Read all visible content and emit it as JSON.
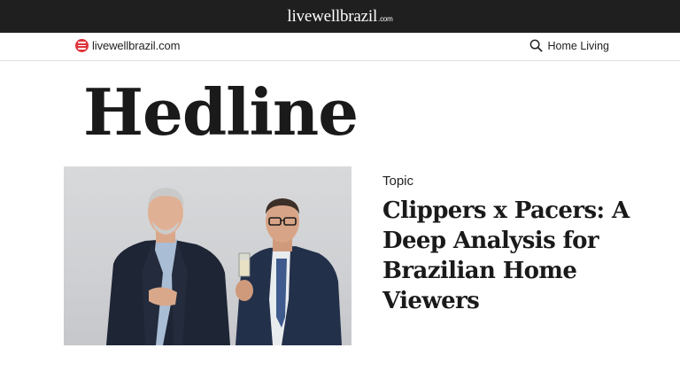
{
  "banner": {
    "brand_main": "livewellbrazil",
    "brand_tld": ".com"
  },
  "nav": {
    "logo_text": "livewellbrazil.com",
    "logo_icon": "menu-lines-icon",
    "search_icon": "search-icon",
    "link_label": "Home Living"
  },
  "headline": "Hedline",
  "article": {
    "topic": "Topic",
    "title": "Clippers x Pacers: A Deep Analysis for Brazilian Home Viewers"
  },
  "colors": {
    "banner_bg": "#1f1f1f",
    "brand_red": "#e0343a",
    "text": "#1a1a1a"
  }
}
